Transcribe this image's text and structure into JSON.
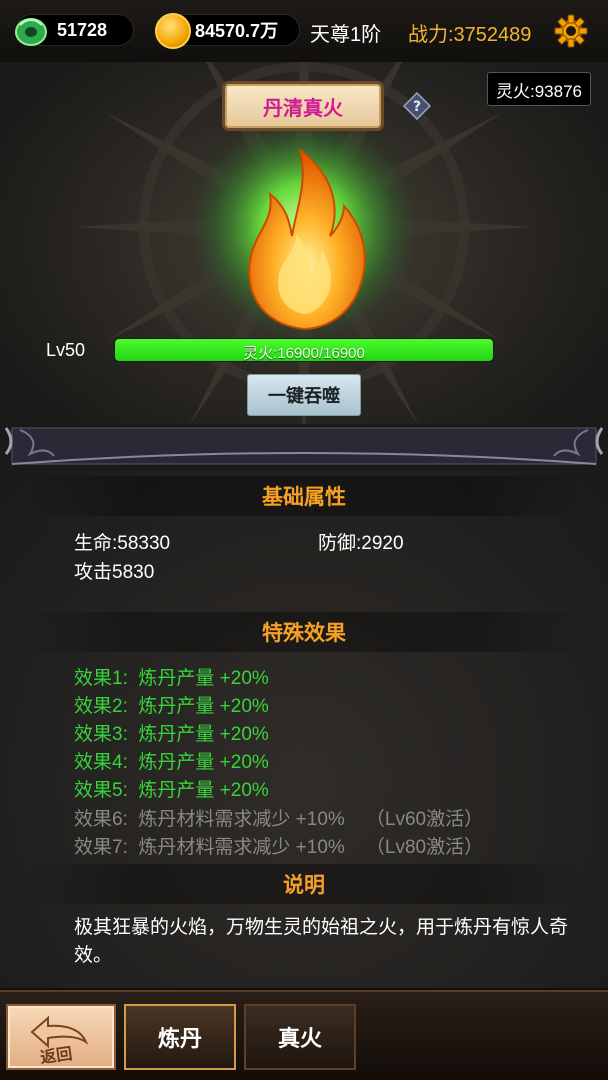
{
  "topbar": {
    "jade_value": "51728",
    "gold_value": "84570.7万",
    "rank": "天尊1阶",
    "power": "战力:3752489"
  },
  "hero": {
    "title": "丹清真火",
    "spirit_fire_total": "灵火:93876",
    "level": "Lv50",
    "bar_text": "灵火:16900/16900",
    "bar_progress": 1.0,
    "devour_button": "一键吞噬"
  },
  "basic": {
    "heading": "基础属性",
    "hp": "生命:58330",
    "defense": "防御:2920",
    "attack": "攻击5830"
  },
  "special": {
    "heading": "特殊效果",
    "effects": [
      {
        "text": "效果1:  炼丹产量 +20%",
        "active": true
      },
      {
        "text": "效果2:  炼丹产量 +20%",
        "active": true
      },
      {
        "text": "效果3:  炼丹产量 +20%",
        "active": true
      },
      {
        "text": "效果4:  炼丹产量 +20%",
        "active": true
      },
      {
        "text": "效果5:  炼丹产量 +20%",
        "active": true
      },
      {
        "text": "效果6:  炼丹材料需求减少 +10%    （Lv60激活）",
        "active": false
      },
      {
        "text": "效果7:  炼丹材料需求减少 +10%    （Lv80激活）",
        "active": false
      }
    ]
  },
  "description": {
    "heading": "说明",
    "text": "极其狂暴的火焰，万物生灵的始祖之火，用于炼丹有惊人奇效。"
  },
  "bottom": {
    "back_label": "返回",
    "tab1": "炼丹",
    "tab2": "真火"
  },
  "colors": {
    "accent_orange": "#f6a024",
    "active_green": "#36d43a",
    "inactive_gray": "#8a8883",
    "title_magenta": "#d21b92",
    "power_gold": "#f3b42a"
  },
  "icons": [
    "jade-icon",
    "coin-icon",
    "gear-icon",
    "help-icon",
    "flame-icon",
    "back-arrow-icon"
  ]
}
